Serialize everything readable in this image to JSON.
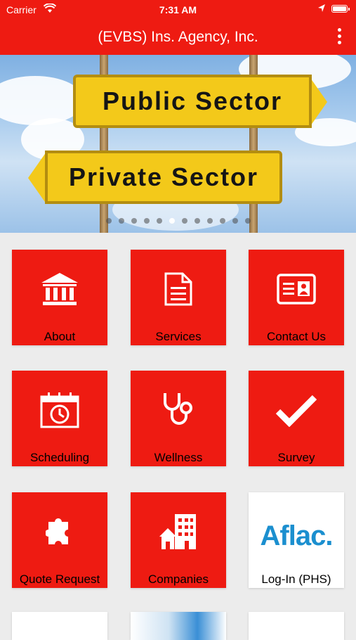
{
  "status_bar": {
    "carrier": "Carrier",
    "time": "7:31 AM"
  },
  "header": {
    "title": "(EVBS) Ins. Agency, Inc."
  },
  "banner": {
    "sign_top": "Public Sector",
    "sign_bottom": "Private Sector",
    "slide_count": 12,
    "active_slide": 5
  },
  "tiles": [
    {
      "label": "About",
      "icon": "bank-icon"
    },
    {
      "label": "Services",
      "icon": "document-icon"
    },
    {
      "label": "Contact Us",
      "icon": "contact-card-icon"
    },
    {
      "label": "Scheduling",
      "icon": "calendar-clock-icon"
    },
    {
      "label": "Wellness",
      "icon": "stethoscope-icon"
    },
    {
      "label": "Survey",
      "icon": "checkmark-icon"
    },
    {
      "label": "Quote Request",
      "icon": "puzzle-icon"
    },
    {
      "label": "Companies",
      "icon": "buildings-icon"
    },
    {
      "label": "Log-In (PHS)",
      "icon": "aflac-logo",
      "logo_text": "Aflac."
    }
  ],
  "colors": {
    "brand": "#ee1b12",
    "aflac_blue": "#1b8fcf"
  }
}
